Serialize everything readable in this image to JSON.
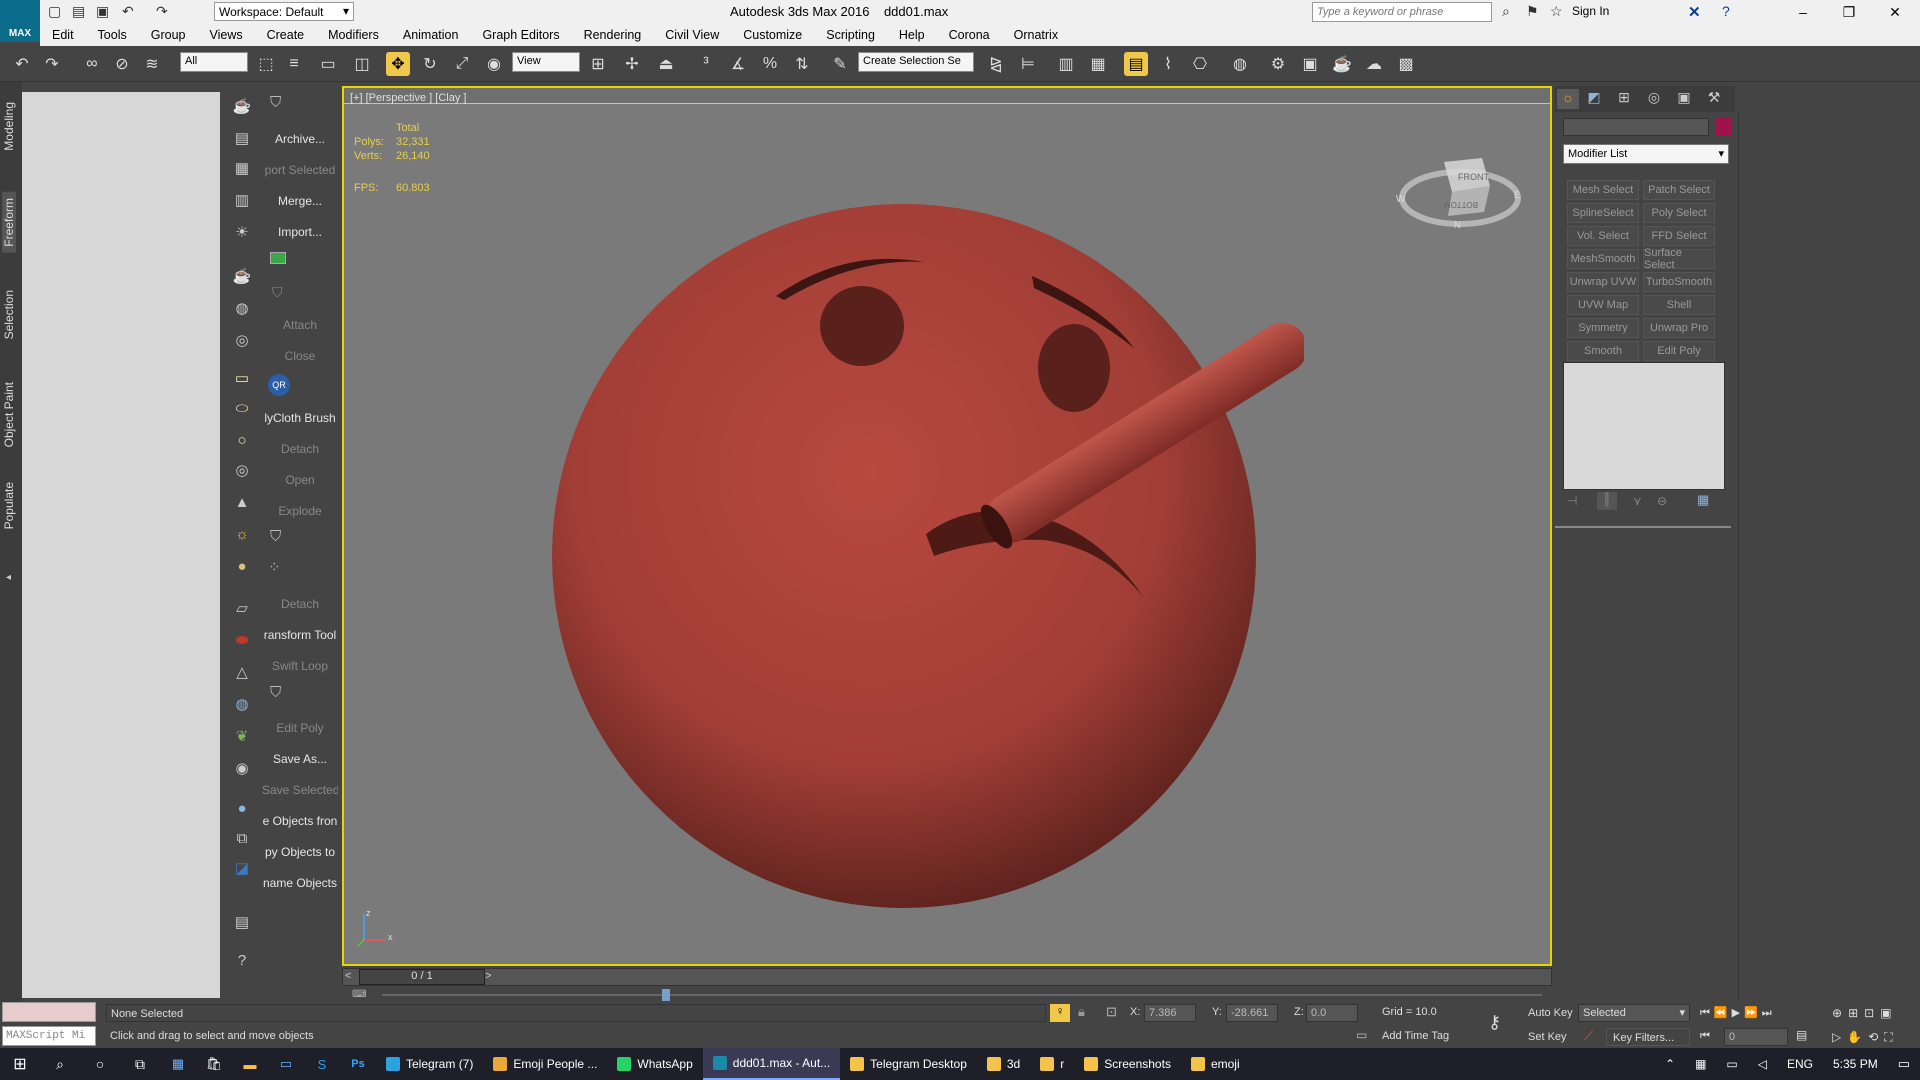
{
  "app": {
    "name": "Autodesk 3ds Max 2016",
    "file": "ddd01.max",
    "logo_text": "MAX",
    "workspace": "Workspace: Default",
    "search_placeholder": "Type a keyword or phrase",
    "sign_in": "Sign In"
  },
  "menu": [
    "Edit",
    "Tools",
    "Group",
    "Views",
    "Create",
    "Modifiers",
    "Animation",
    "Graph Editors",
    "Rendering",
    "Civil View",
    "Customize",
    "Scripting",
    "Help",
    "Corona",
    "Ornatrix"
  ],
  "toolbar": {
    "filter_value": "All",
    "refcoord_value": "View",
    "selection_set_placeholder": "Create Selection Se"
  },
  "left_tabs": [
    "Modeling",
    "Freeform",
    "Selection",
    "Object Paint",
    "Populate"
  ],
  "commands": [
    {
      "label": "Archive...",
      "enabled": true
    },
    {
      "label": "port Selected",
      "enabled": false
    },
    {
      "label": "Merge...",
      "enabled": true
    },
    {
      "label": "Import...",
      "enabled": true
    },
    {
      "label": "Attach",
      "enabled": false
    },
    {
      "label": "Close",
      "enabled": false
    },
    {
      "label": "lyCloth Brush",
      "enabled": true
    },
    {
      "label": "Detach",
      "enabled": false
    },
    {
      "label": "Open",
      "enabled": false
    },
    {
      "label": "Explode",
      "enabled": false
    },
    {
      "label": "Detach",
      "enabled": false
    },
    {
      "label": "ransform Tool",
      "enabled": true
    },
    {
      "label": "Swift Loop",
      "enabled": false
    },
    {
      "label": "Edit Poly",
      "enabled": false
    },
    {
      "label": "Save As...",
      "enabled": true
    },
    {
      "label": "Save Selected",
      "enabled": false
    },
    {
      "label": "e Objects fron",
      "enabled": true
    },
    {
      "label": "py Objects to",
      "enabled": true
    },
    {
      "label": "name Objects",
      "enabled": true
    }
  ],
  "viewport": {
    "label": "[+] [Perspective ] [Clay ]",
    "stats": {
      "total_label": "Total",
      "polys_label": "Polys:",
      "polys": "32,331",
      "verts_label": "Verts:",
      "verts": "26,140",
      "fps_label": "FPS:",
      "fps": "60.803"
    },
    "viewcube": {
      "front": "FRONT",
      "bottom": "BOTTOM",
      "w": "W",
      "n": "N",
      "e": "E"
    },
    "object_color": "#a8413a",
    "axis": {
      "z": "z",
      "x": "x"
    }
  },
  "command_panel": {
    "modifier_list": "Modifier List",
    "color_swatch": "#a0124a",
    "modifiers": [
      "Mesh Select",
      "Patch Select",
      "SplineSelect",
      "Poly Select",
      "Vol. Select",
      "FFD Select",
      "MeshSmooth",
      "Surface Select",
      "Unwrap UVW",
      "TurboSmooth",
      "UVW Map",
      "Shell",
      "Symmetry",
      "Unwrap Pro",
      "Smooth",
      "Edit Poly"
    ]
  },
  "timeline": {
    "frame": "0 / 1"
  },
  "status": {
    "maxscript": "MAXScript Mi",
    "selection": "None Selected",
    "prompt": "Click and drag to select and move objects",
    "x_label": "X:",
    "x": "7.386",
    "y_label": "Y:",
    "y": "-28.661",
    "z_label": "Z:",
    "z": "0.0",
    "grid": "Grid = 10.0",
    "add_time_tag": "Add Time Tag",
    "auto_key": "Auto Key",
    "set_key": "Set Key",
    "selected": "Selected",
    "key_filters": "Key Filters...",
    "frame_value": "0"
  },
  "taskbar": {
    "items": [
      {
        "label": "Telegram (7)",
        "color": "#2aa3e0"
      },
      {
        "label": "Emoji People ...",
        "color": "#e9a93a"
      },
      {
        "label": "WhatsApp",
        "color": "#25d366"
      },
      {
        "label": "ddd01.max - Aut...",
        "color": "#1a8aa8"
      },
      {
        "label": "Telegram Desktop",
        "color": "#f3c34a"
      },
      {
        "label": "3d",
        "color": "#f3c34a"
      },
      {
        "label": "r",
        "color": "#f3c34a"
      },
      {
        "label": "Screenshots",
        "color": "#f3c34a"
      },
      {
        "label": "emoji",
        "color": "#f3c34a"
      }
    ],
    "lang": "ENG",
    "time": "5:35 PM"
  }
}
